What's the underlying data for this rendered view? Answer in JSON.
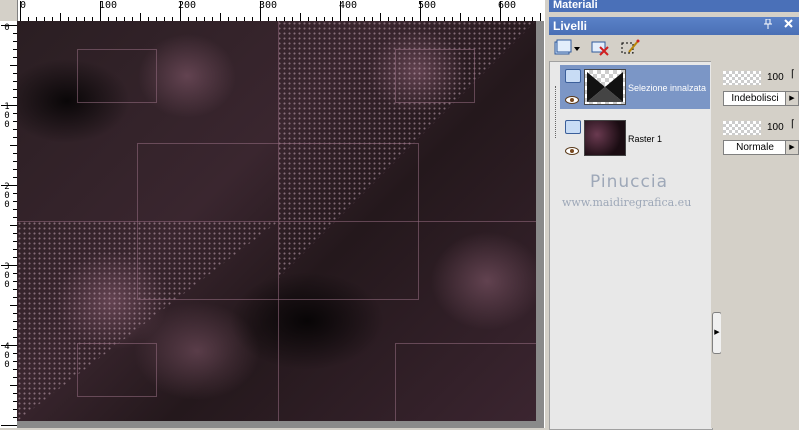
{
  "panels": {
    "materials_title": "Materiali",
    "layers_title": "Livelli"
  },
  "ruler": {
    "top_labels": [
      "0",
      "100",
      "200",
      "300",
      "400",
      "500",
      "600"
    ],
    "left_labels": [
      "0",
      "1 0 0",
      "2 0 0",
      "3 0 0",
      "4 0 0"
    ]
  },
  "layers": [
    {
      "name": "Selezione innalzata",
      "selected": true,
      "opacity": "100",
      "blend_mode": "Indebolisci"
    },
    {
      "name": "Raster 1",
      "selected": false,
      "opacity": "100",
      "blend_mode": "Normale"
    }
  ],
  "watermark": {
    "name": "Pinuccia",
    "url": "www.maidiregrafica.eu"
  },
  "colors": {
    "title_bar": "#4a6fb5",
    "selected_row": "#7b96c6",
    "canvas_base": "#2a1e22"
  },
  "icons": {
    "new_layer": "new-layer-icon",
    "delete_layer": "delete-layer-icon",
    "edit_selection": "edit-selection-icon",
    "visibility": "eye-icon",
    "pin": "pin-icon",
    "close": "close-icon"
  }
}
